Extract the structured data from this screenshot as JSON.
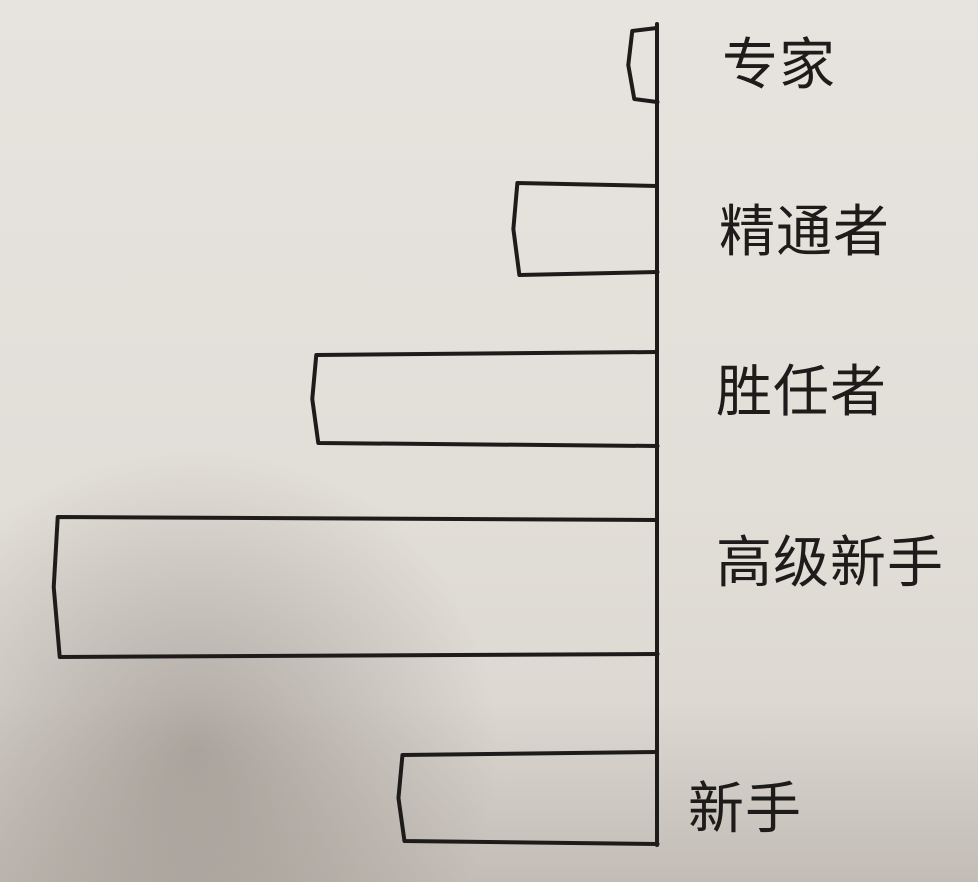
{
  "chart_data": {
    "type": "bar",
    "orientation": "horizontal",
    "categories": [
      "专家",
      "精通者",
      "胜任者",
      "高级新手",
      "新手"
    ],
    "values": [
      1,
      5,
      12,
      21,
      9
    ],
    "xlim": [
      0,
      22
    ],
    "grid": false,
    "legend": "none",
    "title": "",
    "xlabel": "",
    "ylabel": ""
  }
}
